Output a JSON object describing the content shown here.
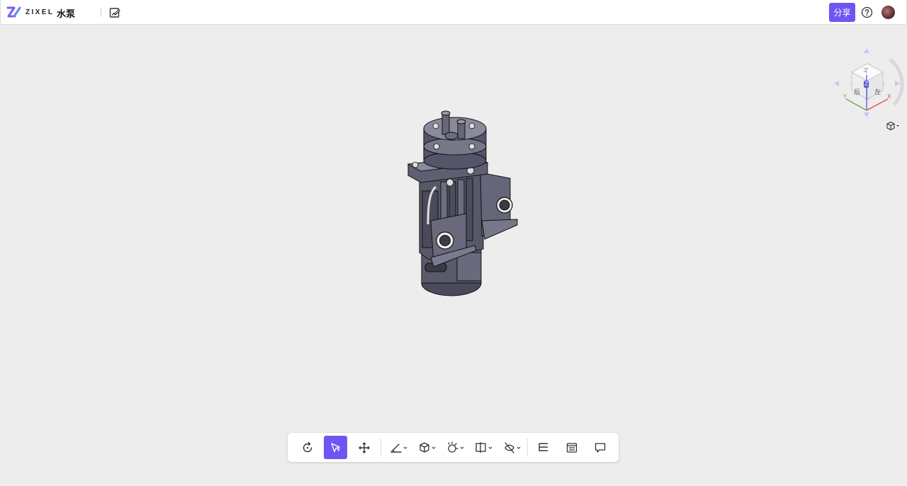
{
  "header": {
    "logo_text": "ZIXEL",
    "document_title": "水泵",
    "share_label": "分享"
  },
  "navcube": {
    "faces": {
      "top": "Z",
      "back": "后",
      "left": "左",
      "front_top": "上"
    },
    "axes": {
      "x": "X",
      "y": "Y"
    }
  },
  "colors": {
    "accent": "#7055f2",
    "axis_x": "#e05050",
    "axis_y": "#6aa84f",
    "axis_z": "#5555dd",
    "model_body": "#555566"
  },
  "toolbar": {
    "tools": [
      {
        "name": "reset-view",
        "icon": "rotate-reset-icon",
        "active": false
      },
      {
        "name": "select",
        "icon": "cursor-select-icon",
        "active": true
      },
      {
        "name": "pan",
        "icon": "move-arrows-icon",
        "active": false
      },
      {
        "name": "measure",
        "icon": "measure-icon",
        "active": false,
        "dropdown": true
      },
      {
        "name": "display-mode",
        "icon": "cube-display-icon",
        "active": false,
        "dropdown": true
      },
      {
        "name": "explode",
        "icon": "explode-icon",
        "active": false,
        "dropdown": true
      },
      {
        "name": "section",
        "icon": "section-plane-icon",
        "active": false,
        "dropdown": true
      },
      {
        "name": "hide",
        "icon": "hide-eye-icon",
        "active": false,
        "dropdown": true
      },
      {
        "name": "model-tree",
        "icon": "tree-list-icon",
        "active": false
      },
      {
        "name": "properties",
        "icon": "properties-panel-icon",
        "active": false
      },
      {
        "name": "comments",
        "icon": "comment-icon",
        "active": false
      }
    ]
  }
}
